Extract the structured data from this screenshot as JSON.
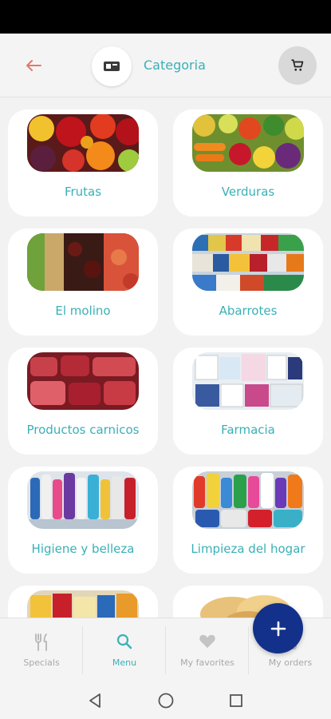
{
  "header": {
    "title": "Categoria",
    "back_icon": "arrow-left-icon",
    "logo_icon": "store-logo-icon",
    "cart_icon": "cart-icon"
  },
  "colors": {
    "accent": "#3ab0b6",
    "back_arrow": "#e07a6b",
    "fab": "#13318a",
    "card_bg": "#ffffff",
    "page_bg": "#f2f2f2"
  },
  "categories": [
    {
      "label": "Frutas",
      "image": "fruits-photo"
    },
    {
      "label": "Verduras",
      "image": "vegetables-photo"
    },
    {
      "label": "El molino",
      "image": "grains-peppers-photo"
    },
    {
      "label": "Abarrotes",
      "image": "groceries-shelf-photo"
    },
    {
      "label": "Productos carnicos",
      "image": "meat-photo"
    },
    {
      "label": "Farmacia",
      "image": "pharmacy-boxes-photo"
    },
    {
      "label": "Higiene y belleza",
      "image": "hygiene-products-photo"
    },
    {
      "label": "Limpieza del hogar",
      "image": "cleaning-products-photo"
    },
    {
      "label": "",
      "image": "packaged-goods-photo"
    },
    {
      "label": "",
      "image": "bread-photo"
    }
  ],
  "bottom_nav": [
    {
      "label": "Specials",
      "icon": "fork-knife-icon",
      "active": false
    },
    {
      "label": "Menu",
      "icon": "search-icon",
      "active": true
    },
    {
      "label": "My favorites",
      "icon": "heart-icon",
      "active": false
    },
    {
      "label": "My orders",
      "icon": "orders-icon",
      "active": false
    }
  ],
  "fab": {
    "icon": "plus-icon"
  },
  "system_nav": [
    "back-triangle-icon",
    "home-circle-icon",
    "recents-square-icon"
  ]
}
